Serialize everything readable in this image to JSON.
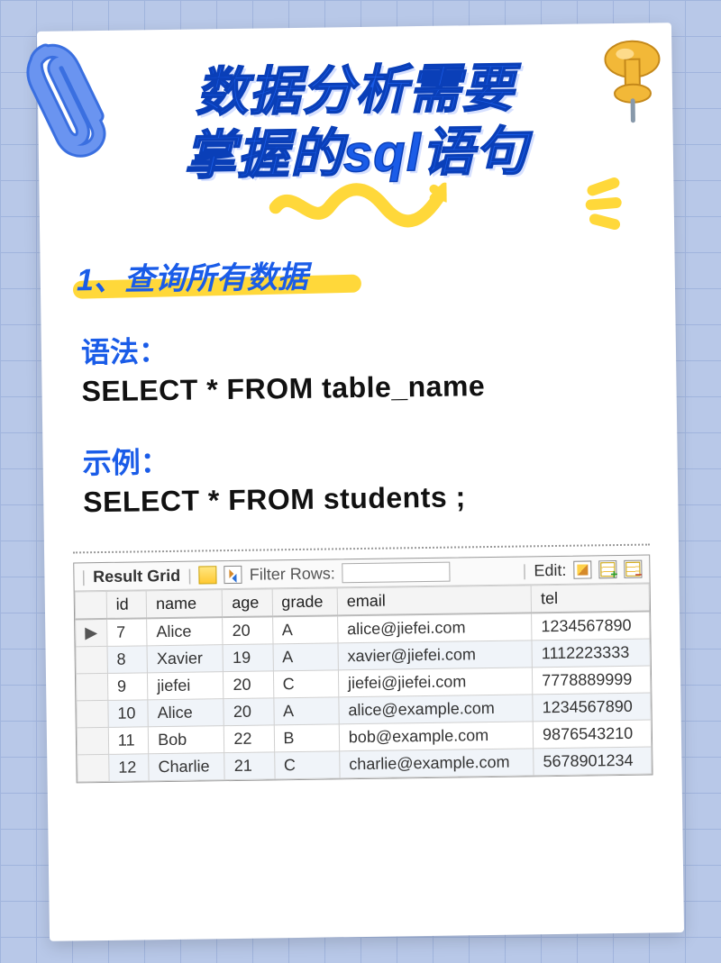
{
  "title_line1": "数据分析需要",
  "title_line2": "掌握的sql语句",
  "section_number_title": "1、查询所有数据",
  "syntax_label": "语法：",
  "syntax_code": "SELECT * FROM table_name",
  "example_label": "示例：",
  "example_code": "SELECT * FROM students ;",
  "toolbar": {
    "result_grid": "Result Grid",
    "filter_label": "Filter Rows:",
    "filter_placeholder": "",
    "edit_label": "Edit:"
  },
  "columns": [
    "id",
    "name",
    "age",
    "grade",
    "email",
    "tel"
  ],
  "rows": [
    {
      "cursor": "▶",
      "id": "7",
      "name": "Alice",
      "age": "20",
      "grade": "A",
      "email": "alice@jiefei.com",
      "tel": "1234567890"
    },
    {
      "cursor": "",
      "id": "8",
      "name": "Xavier",
      "age": "19",
      "grade": "A",
      "email": "xavier@jiefei.com",
      "tel": "1112223333"
    },
    {
      "cursor": "",
      "id": "9",
      "name": "jiefei",
      "age": "20",
      "grade": "C",
      "email": "jiefei@jiefei.com",
      "tel": "7778889999"
    },
    {
      "cursor": "",
      "id": "10",
      "name": "Alice",
      "age": "20",
      "grade": "A",
      "email": "alice@example.com",
      "tel": "1234567890"
    },
    {
      "cursor": "",
      "id": "11",
      "name": "Bob",
      "age": "22",
      "grade": "B",
      "email": "bob@example.com",
      "tel": "9876543210"
    },
    {
      "cursor": "",
      "id": "12",
      "name": "Charlie",
      "age": "21",
      "grade": "C",
      "email": "charlie@example.com",
      "tel": "5678901234"
    }
  ]
}
